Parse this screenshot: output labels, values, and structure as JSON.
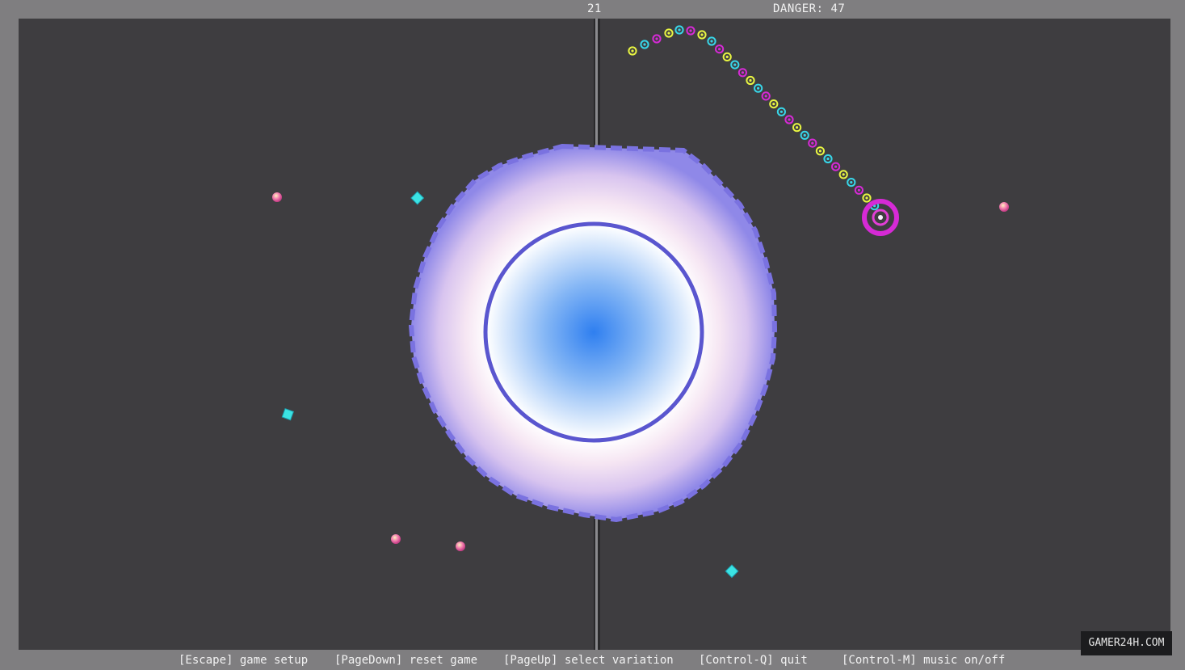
{
  "hud": {
    "score": "21",
    "danger_label": "DANGER:",
    "danger_value": "47"
  },
  "colors": {
    "frame": "#7f7e80",
    "arena": "#3e3d40",
    "snake_yellow": "#e8f542",
    "snake_cyan": "#38d6e8",
    "snake_magenta": "#d62ad6",
    "gem_cyan": "#3be3e3",
    "orb_pink": "#f07ab4",
    "core_blue": "#2f7ff0",
    "ring_violet": "#6b64d8"
  },
  "footer": {
    "hints": [
      "[Escape] game setup",
      "[PageDown] reset game",
      "[PageUp] select variation",
      "[Control-Q] quit",
      "[Control-M] music on/off"
    ]
  },
  "watermark": "GAMER24H.COM",
  "scene": {
    "icons": [
      "snake-head-icon",
      "cyan-gem-icon",
      "pink-orb-icon",
      "black-hole-icon"
    ]
  }
}
